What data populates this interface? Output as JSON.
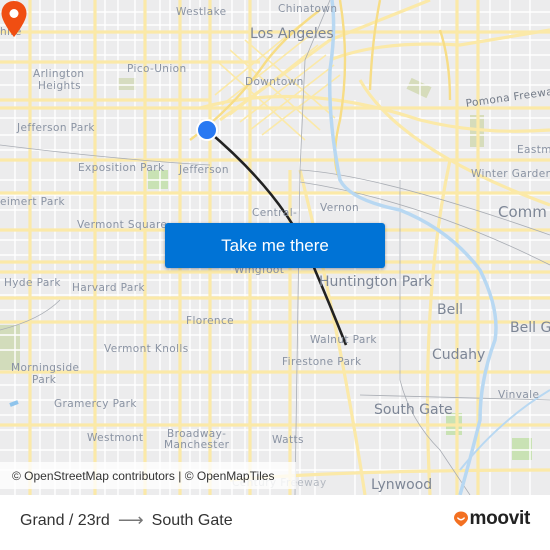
{
  "map": {
    "labels": [
      {
        "id": "westlake",
        "text": "Westlake"
      },
      {
        "id": "chinatown",
        "text": "Chinatown"
      },
      {
        "id": "wilshire",
        "text": "hire"
      },
      {
        "id": "los-angeles",
        "text": "Los Angeles"
      },
      {
        "id": "arlington-heights-1",
        "text": "Arlington"
      },
      {
        "id": "arlington-heights-2",
        "text": "Heights"
      },
      {
        "id": "pico-union",
        "text": "Pico-Union"
      },
      {
        "id": "downtown",
        "text": "Downtown"
      },
      {
        "id": "pomona-freeway",
        "text": "Pomona Freeway"
      },
      {
        "id": "jefferson-park",
        "text": "Jefferson Park"
      },
      {
        "id": "eastmont",
        "text": "Eastm"
      },
      {
        "id": "exposition-park",
        "text": "Exposition Park"
      },
      {
        "id": "jefferson",
        "text": "Jefferson"
      },
      {
        "id": "winter-gardens",
        "text": "Winter Garden"
      },
      {
        "id": "leimert-park",
        "text": "eimert Park"
      },
      {
        "id": "central-alameda",
        "text": "Central-"
      },
      {
        "id": "vernon",
        "text": "Vernon"
      },
      {
        "id": "commerce",
        "text": "Comm"
      },
      {
        "id": "vermont-square",
        "text": "Vermont Square"
      },
      {
        "id": "wingfoot",
        "text": "Wingfoot"
      },
      {
        "id": "hyde-park",
        "text": "Hyde Park"
      },
      {
        "id": "harvard-park",
        "text": "Harvard Park"
      },
      {
        "id": "huntington-park",
        "text": "Huntington Park"
      },
      {
        "id": "bell",
        "text": "Bell"
      },
      {
        "id": "bell-gardens",
        "text": "Bell G"
      },
      {
        "id": "florence",
        "text": "Florence"
      },
      {
        "id": "walnut-park",
        "text": "Walnut Park"
      },
      {
        "id": "vermont-knolls",
        "text": "Vermont Knolls"
      },
      {
        "id": "cudahy",
        "text": "Cudahy"
      },
      {
        "id": "morningside-park-1",
        "text": "Morningside"
      },
      {
        "id": "morningside-park-2",
        "text": "Park"
      },
      {
        "id": "firestone-park",
        "text": "Firestone Park"
      },
      {
        "id": "vinvale",
        "text": "Vinvale"
      },
      {
        "id": "gramercy-park",
        "text": "Gramercy Park"
      },
      {
        "id": "south-gate",
        "text": "South Gate"
      },
      {
        "id": "westmont",
        "text": "Westmont"
      },
      {
        "id": "broadway-manchester-1",
        "text": "Broadway-"
      },
      {
        "id": "broadway-manchester-2",
        "text": "Manchester"
      },
      {
        "id": "watts",
        "text": "Watts"
      },
      {
        "id": "lynwood",
        "text": "Lynwood"
      },
      {
        "id": "century-freeway",
        "text": "Century Freeway"
      }
    ],
    "origin_marker": {
      "name": "Grand / 23rd",
      "color": "#2979f2"
    },
    "destination_marker": {
      "name": "South Gate",
      "color": "#f04e12"
    },
    "route_line_color": "#222222",
    "attribution": "© OpenStreetMap contributors | © OpenMapTiles"
  },
  "cta": {
    "label": "Take me there",
    "color": "#0073d6"
  },
  "footer": {
    "origin": "Grand / 23rd",
    "arrow": "⟶",
    "destination": "South Gate",
    "brand": "moovit",
    "brand_color": "#f37021"
  }
}
